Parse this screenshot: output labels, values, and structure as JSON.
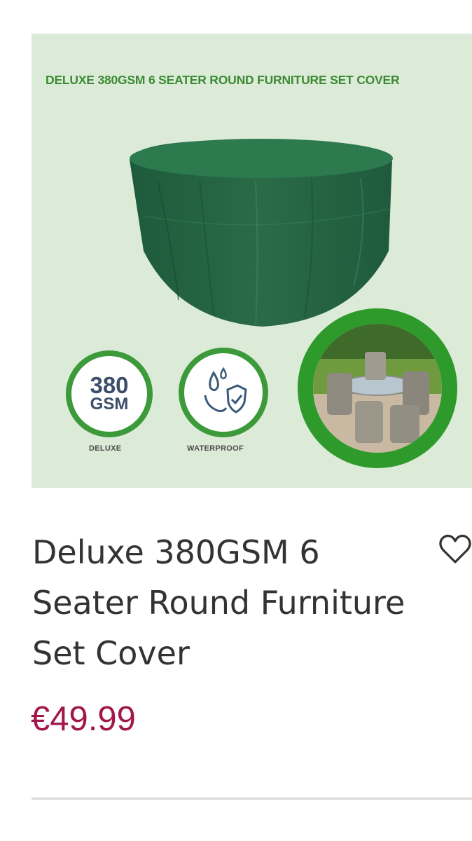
{
  "product": {
    "image": {
      "banner_text": "DELUXE 380GSM 6 SEATER ROUND FURNITURE SET COVER",
      "badges": [
        {
          "value": "380",
          "unit": "GSM",
          "caption": "DELUXE"
        },
        {
          "icon": "waterproof-icon",
          "caption": "WATERPROOF"
        }
      ],
      "background_color": "#dcebd8",
      "accent_color": "#3c9a3a"
    },
    "title": "Deluxe 380GSM 6 Seater Round Furniture Set Cover",
    "price": "€49.99",
    "price_color": "#a1174a",
    "favorite_icon": "heart-outline-icon"
  }
}
